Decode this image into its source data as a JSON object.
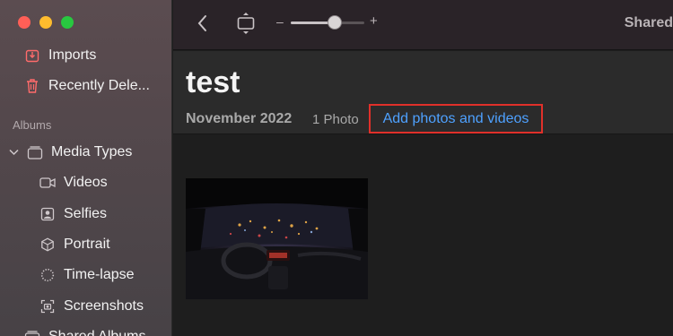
{
  "sidebar": {
    "items": [
      {
        "label": "Imports",
        "icon": "import-icon"
      },
      {
        "label": "Recently Dele...",
        "icon": "trash-icon"
      }
    ],
    "section_label": "Albums",
    "media_types": {
      "label": "Media Types",
      "children": [
        {
          "label": "Videos",
          "icon": "video-icon"
        },
        {
          "label": "Selfies",
          "icon": "selfie-icon"
        },
        {
          "label": "Portrait",
          "icon": "portrait-icon"
        },
        {
          "label": "Time-lapse",
          "icon": "timelapse-icon"
        },
        {
          "label": "Screenshots",
          "icon": "screenshot-icon"
        }
      ]
    },
    "shared_albums": {
      "label": "Shared Albums"
    }
  },
  "toolbar": {
    "zoom_minus": "–",
    "zoom_plus": "+",
    "zoom_level": 0.6,
    "shared_label": "Shared"
  },
  "album": {
    "title": "test",
    "date": "November 2022",
    "count": "1 Photo",
    "add_label": "Add photos and videos"
  },
  "colors": {
    "accent_link": "#4ea1ff",
    "highlight_box": "#e0302a"
  }
}
